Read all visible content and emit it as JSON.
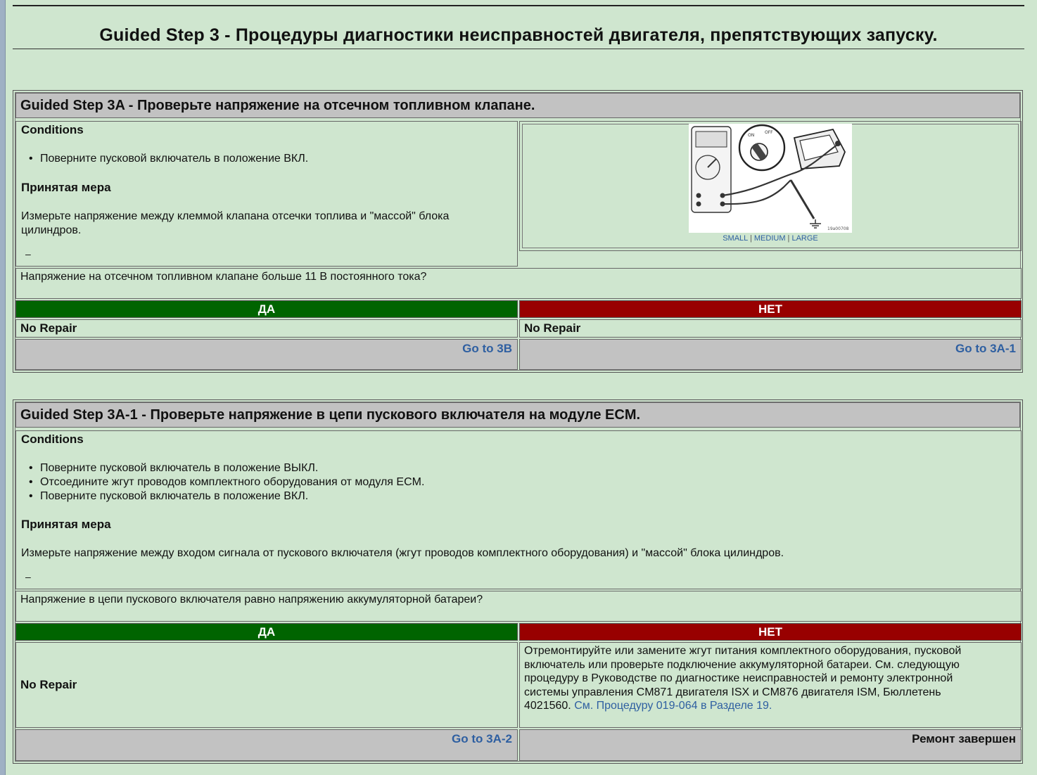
{
  "page_title": "Guided Step 3 - Процедуры диагностики неисправностей двигателя, препятствующих запуску.",
  "step_3a": {
    "header": "Guided Step 3A - Проверьте напряжение на отсечном топливном клапане.",
    "conditions_label": "Conditions",
    "conditions": [
      "Поверните пусковой включатель в положение ВКЛ."
    ],
    "action_label": "Принятая мера",
    "action_line1": "Измерьте напряжение между клеммой клапана отсечки топлива и \"массой\" блока",
    "action_line2": "цилиндров.",
    "dash": "–",
    "image_sizes": {
      "small": "SMALL",
      "medium": "MEDIUM",
      "large": "LARGE",
      "sep": "|"
    },
    "image_code": "19a00708",
    "question": "Напряжение на отсечном топливном клапане больше 11 В постоянного тока?",
    "yes_label": "ДА",
    "no_label": "НЕТ",
    "yes_result": "No Repair",
    "no_result": "No Repair",
    "yes_goto": "Go to 3B",
    "no_goto": "Go to 3A-1"
  },
  "step_3a1": {
    "header": "Guided Step 3A-1 - Проверьте напряжение в цепи пускового включателя на модуле ECM.",
    "conditions_label": "Conditions",
    "conditions": [
      "Поверните пусковой включатель в положение ВЫКЛ.",
      "Отсоедините жгут проводов комплектного оборудования от модуля ECM.",
      "Поверните пусковой включатель в положение ВКЛ."
    ],
    "action_label": "Принятая мера",
    "action": "Измерьте напряжение между входом сигнала от пускового включателя (жгут проводов комплектного оборудования) и \"массой\" блока цилиндров.",
    "dash": "–",
    "question": "Напряжение в цепи пускового включателя равно напряжению аккумуляторной батареи?",
    "yes_label": "ДА",
    "no_label": "НЕТ",
    "yes_result": "No Repair",
    "no_result_l1": "Отремонтируйте или замените жгут питания комплектного оборудования, пусковой",
    "no_result_l2": "включатель или проверьте подключение аккумуляторной батареи. См. следующую",
    "no_result_l3": "процедуру в Руководстве по диагностике неисправностей и ремонту электронной",
    "no_result_l4": "системы управления CM871 двигателя ISX и CM876 двигателя ISM, Бюллетень",
    "no_result_l5": "4021560.",
    "no_result_link": "См. Процедуру 019-064 в Разделе 19.",
    "yes_goto": "Go to 3A-2",
    "no_done": "Ремонт завершен"
  },
  "colors": {
    "background": "#cfe6cf",
    "header_gray": "#c2c2c2",
    "yes_green": "#006400",
    "no_red": "#980000",
    "link_blue": "#2e5fa1"
  }
}
